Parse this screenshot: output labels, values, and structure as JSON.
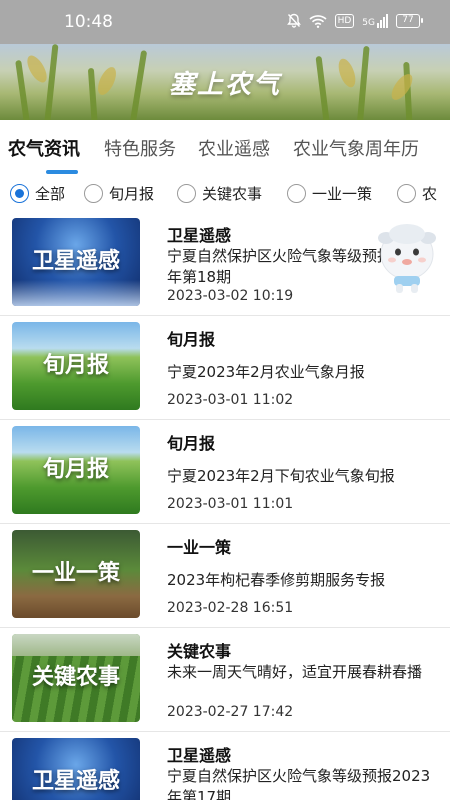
{
  "status_bar": {
    "time": "10:48",
    "icons": [
      "bell-off-icon",
      "wifi-icon",
      "hd-icon",
      "signal-5g-icon",
      "battery-icon"
    ],
    "hd_label": "HD",
    "network_label": "5G",
    "battery_level": "77"
  },
  "banner": {
    "title": "塞上农气"
  },
  "tabs": [
    {
      "label": "农气资讯",
      "active": true
    },
    {
      "label": "特色服务",
      "active": false
    },
    {
      "label": "农业遥感",
      "active": false
    },
    {
      "label": "农业气象周年历",
      "active": false
    }
  ],
  "filters": [
    {
      "label": "全部",
      "checked": true
    },
    {
      "label": "旬月报",
      "checked": false
    },
    {
      "label": "关键农事",
      "checked": false
    },
    {
      "label": "一业一策",
      "checked": false
    },
    {
      "label": "农",
      "checked": false
    }
  ],
  "items": [
    {
      "thumb_label": "卫星遥感",
      "title": "卫星遥感",
      "desc": "宁夏自然保护区火险气象等级预报2023年第18期",
      "date": "2023-03-02 10:19"
    },
    {
      "thumb_label": "旬月报",
      "title": "旬月报",
      "desc": "宁夏2023年2月农业气象月报",
      "date": "2023-03-01 11:02"
    },
    {
      "thumb_label": "旬月报",
      "title": "旬月报",
      "desc": "宁夏2023年2月下旬农业气象旬报",
      "date": "2023-03-01 11:01"
    },
    {
      "thumb_label": "一业一策",
      "title": "一业一策",
      "desc": "2023年枸杞春季修剪期服务专报",
      "date": "2023-02-28 16:51"
    },
    {
      "thumb_label": "关键农事",
      "title": "关键农事",
      "desc": "未来一周天气晴好，适宜开展春耕春播",
      "date": "2023-02-27 17:42"
    },
    {
      "thumb_label": "卫星遥感",
      "title": "卫星遥感",
      "desc": "宁夏自然保护区火险气象等级预报2023年第17期",
      "date": ""
    }
  ],
  "colors": {
    "accent": "#2b8be0",
    "radio_checked": "#1a73d9",
    "status_bar_bg": "#a9a9a9"
  }
}
